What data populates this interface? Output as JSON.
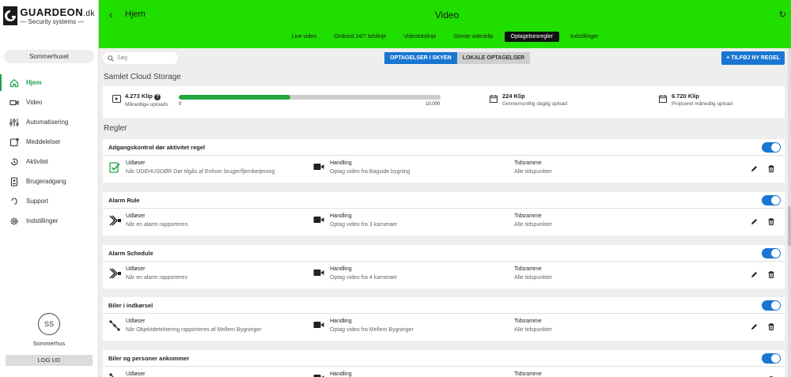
{
  "brand": {
    "name": "GUARDEON",
    "domain": ".dk",
    "tagline": "Security systems",
    "accent": "#1fde00",
    "primary": "#1976d2"
  },
  "sidebar": {
    "site": "Sommerhuset",
    "items": [
      {
        "label": "Hjem",
        "icon": "home-icon"
      },
      {
        "label": "Video",
        "icon": "video-icon"
      },
      {
        "label": "Automatisering",
        "icon": "sliders-icon"
      },
      {
        "label": "Meddelelser",
        "icon": "message-icon"
      },
      {
        "label": "Aktivitet",
        "icon": "activity-icon"
      },
      {
        "label": "Brugeradgang",
        "icon": "user-access-icon"
      },
      {
        "label": "Support",
        "icon": "support-icon"
      },
      {
        "label": "Indstillinger",
        "icon": "gear-icon"
      }
    ],
    "user_initials": "SS",
    "user_name": "Sommerhus",
    "logout_label": "LOG UD"
  },
  "header": {
    "back_label": "Hjem",
    "title": "Video",
    "tabs": [
      "Live video",
      "Ombord 24/7 tidslinje",
      "Videotidslinje",
      "Gemte videoklip",
      "Optagelsesregler",
      "Indstillinger"
    ],
    "active_tab": "Optagelsesregler"
  },
  "toolbar": {
    "search_placeholder": "Søg",
    "toggle_cloud": "OPTAGELSER I SKYEN",
    "toggle_local": "LOKALE OPTAGELSER",
    "add_rule": "TILFØJ NY REGEL"
  },
  "storage": {
    "title": "Samlet Cloud Storage",
    "monthly_value": "4.273 Klip",
    "monthly_label": "Månedlige uploads",
    "progress_fraction": 0.4273,
    "progress_min": "0",
    "progress_max": "10.000",
    "daily_value": "224 Klip",
    "daily_label": "Gennemsnitlig daglig upload",
    "projected_value": "6.720 Klip",
    "projected_label": "Projiceret månedlig upload"
  },
  "rules": {
    "title": "Regler",
    "trigger_label": "Udløser",
    "action_label": "Handling",
    "time_label": "Tidsramme",
    "items": [
      {
        "name": "Adgangskontrol dør aktivitet regel",
        "trigger": "Når UDEHUSDØR Dør tilgås af Enhver bruger/fjernbetjening",
        "trigger_icon": "door-check-icon",
        "action": "Optag video fra Bagside bygning",
        "time": "Alle tidspunkter",
        "enabled": true
      },
      {
        "name": "Alarm Rule",
        "trigger": "Når en alarm rapporteres",
        "trigger_icon": "alarm-siren-icon",
        "action": "Optag video fra 3 kameraer",
        "time": "Alle tidspunkter",
        "enabled": true
      },
      {
        "name": "Alarm Schedule",
        "trigger": "Når en alarm rapporteres",
        "trigger_icon": "alarm-siren-icon",
        "action": "Optag video fra 4 kameraer",
        "time": "Alle tidspunkter",
        "enabled": true
      },
      {
        "name": "Biler i indkørsel",
        "trigger": "Når Objektdetektering rapporteres af Mellem Bygninger",
        "trigger_icon": "object-detection-icon",
        "action": "Optag video fra Mellem Bygninger",
        "time": "Alle tidspunkter",
        "enabled": true
      },
      {
        "name": "Biler og personer ankommer",
        "trigger": "",
        "trigger_icon": "object-detection-icon",
        "action": "",
        "time": "",
        "enabled": true
      }
    ]
  }
}
